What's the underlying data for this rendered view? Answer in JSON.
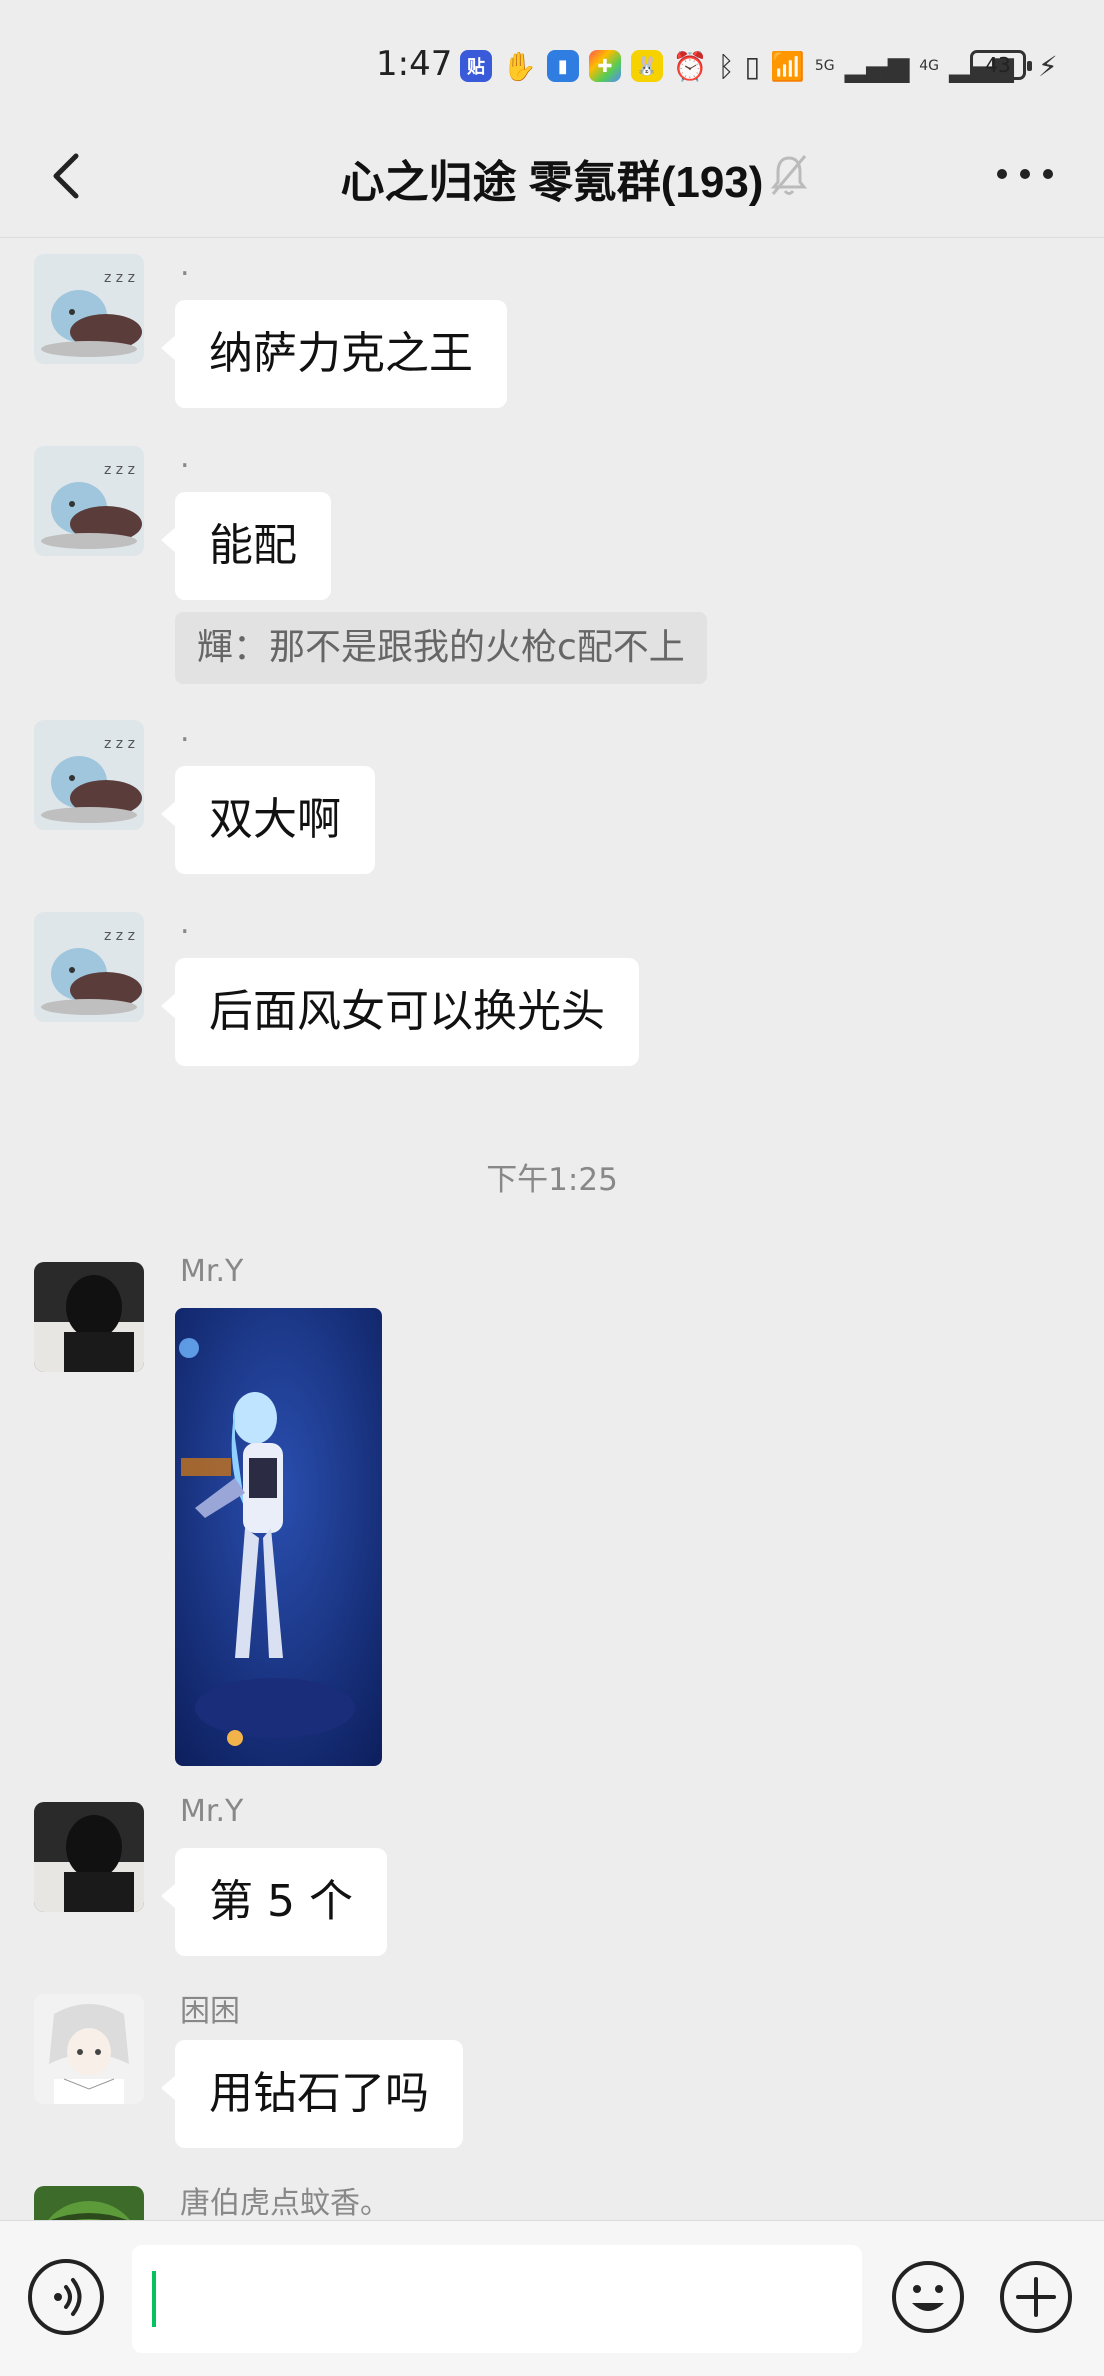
{
  "status_bar": {
    "time": "1:47",
    "battery": "43",
    "network_labels": [
      "5G",
      "4G"
    ]
  },
  "header": {
    "title": "心之归途 零氪群(193)",
    "muted": true
  },
  "messages": [
    {
      "type": "text",
      "sender": ".",
      "avatar": "sleepy-blob-avatar",
      "text": "纳萨力克之王"
    },
    {
      "type": "text",
      "sender": ".",
      "avatar": "sleepy-blob-avatar",
      "text": "能配",
      "quote": "輝：那不是跟我的火枪c配不上"
    },
    {
      "type": "text",
      "sender": ".",
      "avatar": "sleepy-blob-avatar",
      "text": "双大啊"
    },
    {
      "type": "text",
      "sender": ".",
      "avatar": "sleepy-blob-avatar",
      "text": "后面风女可以换光头"
    },
    {
      "type": "time",
      "text": "下午1:25"
    },
    {
      "type": "image",
      "sender": "Mr.Y",
      "avatar": "dark-figure-avatar",
      "image": "game-character-screenshot"
    },
    {
      "type": "text",
      "sender": "Mr.Y",
      "avatar": "dark-figure-avatar",
      "text": "第 5 个"
    },
    {
      "type": "text",
      "sender": "困困",
      "avatar": "white-hair-anime-avatar",
      "text": "用钻石了吗"
    },
    {
      "type": "text",
      "sender": "唐伯虎点蚊香。",
      "avatar": "watermelon-avatar",
      "text": ""
    }
  ],
  "input_bar": {
    "value": "",
    "icons": [
      "voice-icon",
      "emoji-icon",
      "plus-icon"
    ]
  },
  "colors": {
    "background": "#ededed",
    "bubble": "#ffffff",
    "accent": "#07c160"
  }
}
